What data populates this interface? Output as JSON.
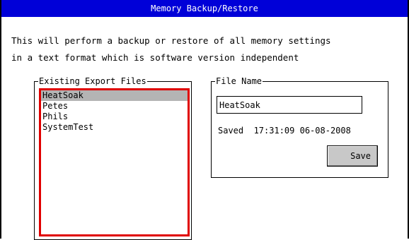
{
  "window": {
    "title": "Memory Backup/Restore"
  },
  "description": {
    "line1": "This will perform a backup or restore of all memory settings",
    "line2": "in a text format which is software version independent"
  },
  "files": {
    "label": "Existing Export Files",
    "items": [
      "HeatSoak",
      "Petes",
      "Phils",
      "SystemTest"
    ],
    "selected": "HeatSoak"
  },
  "filename": {
    "label": "File Name",
    "value": "HeatSoak",
    "saved_text": "Saved  17:31:09 06-08-2008",
    "save_label": "Save"
  },
  "colors": {
    "titlebar": "#0000d8",
    "list_focus_border": "#e00000",
    "selection": "#b4b4b4",
    "button": "#c8c8c8"
  }
}
